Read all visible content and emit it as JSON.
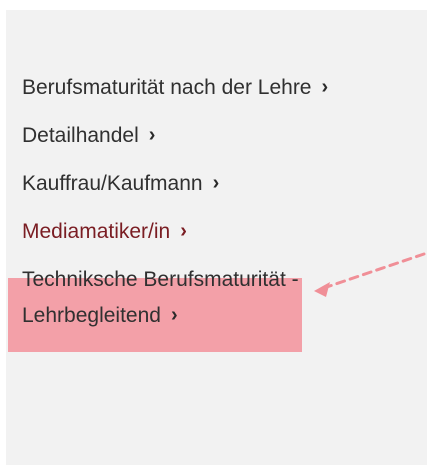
{
  "menu": {
    "items": [
      {
        "label": "Berufsmaturität nach der Lehre"
      },
      {
        "label": "Detailhandel"
      },
      {
        "label": "Kauffrau/Kaufmann"
      },
      {
        "label": "Mediamatiker/in",
        "active": true
      },
      {
        "label": "Techniksche Berufsmaturität - Lehrbegleitend"
      }
    ],
    "chevron": "›"
  },
  "colors": {
    "highlight": "#f3a0a8",
    "arrow": "#f08f97"
  }
}
